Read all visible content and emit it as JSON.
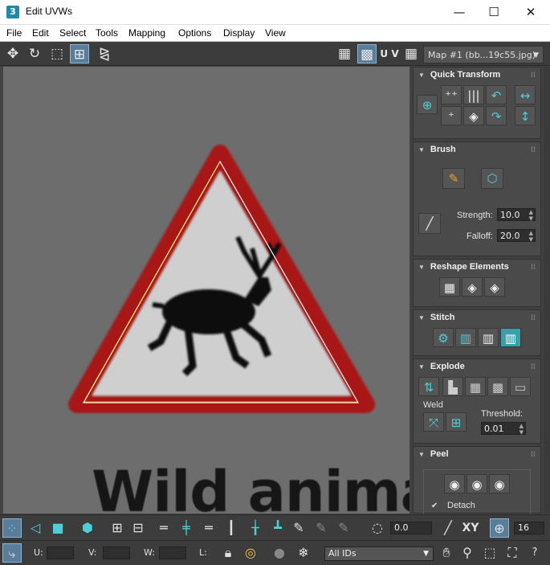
{
  "window": {
    "title": "Edit UVWs",
    "app_icon": "3",
    "minimize": "—",
    "maximize": "☐",
    "close": "✕"
  },
  "menu": [
    "File",
    "Edit",
    "Select",
    "Tools",
    "Mapping",
    "Options",
    "Display",
    "View"
  ],
  "toolbar": {
    "uv_label": "U V",
    "map_select": "Map #1 (bb...19c55.jpg)"
  },
  "viewport": {
    "sign_text": "Wild animals"
  },
  "panel": {
    "quick_transform": {
      "title": "Quick Transform"
    },
    "brush": {
      "title": "Brush",
      "strength_label": "Strength:",
      "strength_value": "10.0",
      "falloff_label": "Falloff:",
      "falloff_value": "20.0"
    },
    "reshape": {
      "title": "Reshape Elements"
    },
    "stitch": {
      "title": "Stitch"
    },
    "explode": {
      "title": "Explode",
      "weld_label": "Weld",
      "threshold_label": "Threshold:",
      "threshold_value": "0.01"
    },
    "peel": {
      "title": "Peel",
      "detach_label": "Detach"
    }
  },
  "bottom": {
    "spinner_value": "0.0",
    "xy_label": "XY",
    "grid_value": "16",
    "u_label": "U:",
    "v_label": "V:",
    "w_label": "W:",
    "l_label": "L:",
    "ids_select": "All IDs"
  },
  "colors": {
    "accent": "#4cd0d8",
    "sign_red": "#b01c1c",
    "highlight": "#5a7e9a"
  }
}
